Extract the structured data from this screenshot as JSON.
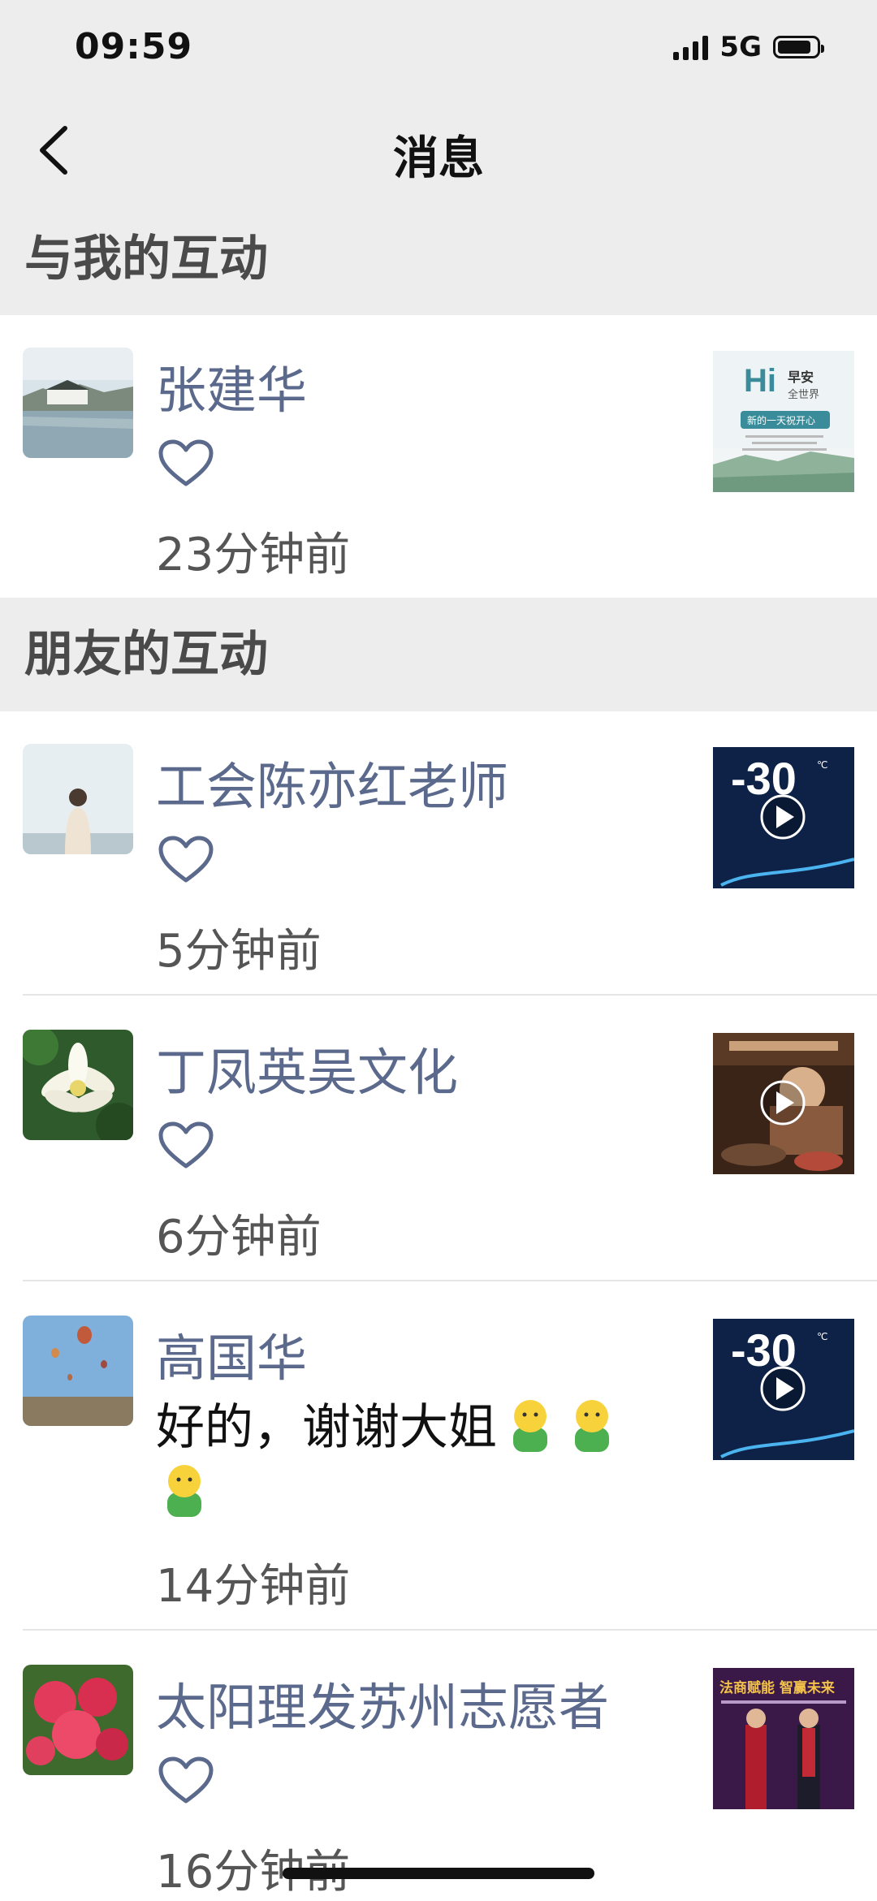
{
  "status": {
    "time": "09:59",
    "network": "5G"
  },
  "nav": {
    "title": "消息",
    "back_icon": "chevron-left-icon"
  },
  "sections": [
    {
      "title": "与我的互动",
      "items": [
        {
          "name": "张建华",
          "type": "like",
          "time_ago": "23分钟前",
          "thumb_text": {
            "hi": "Hi",
            "t1": "早安",
            "t2": "全世界",
            "t3": "新的一天祝开心"
          }
        }
      ]
    },
    {
      "title": "朋友的互动",
      "items": [
        {
          "name": "工会陈亦红老师",
          "type": "like",
          "time_ago": "5分钟前",
          "thumb_text": {
            "temp": "-30",
            "unit": "℃"
          }
        },
        {
          "name": "丁凤英吴文化",
          "type": "like",
          "time_ago": "6分钟前"
        },
        {
          "name": "高国华",
          "type": "comment",
          "message": "好的，谢谢大姐",
          "time_ago": "14分钟前",
          "thumb_text": {
            "temp": "-30",
            "unit": "℃"
          }
        },
        {
          "name": "太阳理发苏州志愿者",
          "type": "like",
          "time_ago": "16分钟前",
          "thumb_text": {
            "banner": "法商赋能 智赢未来"
          }
        }
      ]
    }
  ],
  "colors": {
    "name": "#5b6a8c",
    "header_bg": "#ededed",
    "heart": "#5b6a8c"
  }
}
